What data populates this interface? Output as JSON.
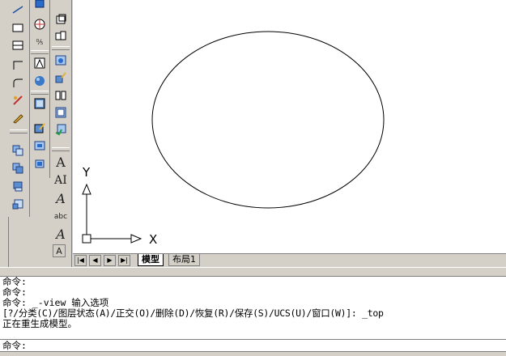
{
  "icons": {
    "col1": [
      "line-icon",
      "rectangle-icon",
      "polyline-icon",
      "arc-icon",
      "hatch-icon",
      "pen-icon",
      "copy-icon",
      "move-icon",
      "array-icon",
      "scale-icon"
    ],
    "col2": [
      "3d-box-icon",
      "globe-icon",
      "ruler-icon",
      "view-icon",
      "sphere-icon",
      "plane-icon",
      "edit-icon",
      "render-icon",
      "cube-icon"
    ],
    "col3": [
      "3d-view-icon",
      "3d-orbit-icon",
      "camera-icon",
      "paint-icon",
      "layers-icon",
      "solid-icon",
      "rotate-icon"
    ]
  },
  "text_tools": {
    "t1": "A",
    "t2": "AI",
    "t3": "A",
    "t4": "abc",
    "t5": "A",
    "t6": "A"
  },
  "ucs": {
    "y_label": "Y",
    "x_label": "X"
  },
  "tabs": {
    "nav": [
      "|◀",
      "◀",
      "▶",
      "▶|"
    ],
    "model": "模型",
    "layout1": "布局1"
  },
  "command": {
    "history": [
      "命令:",
      "命令:",
      "命令: _-view 输入选项",
      "[?/分类(C)/图层状态(A)/正交(O)/删除(D)/恢复(R)/保存(S)/UCS(U)/窗口(W)]: _top",
      "正在重生成模型。"
    ],
    "prompt": "命令:"
  },
  "colors": {
    "ui_gray": "#d4d0c8",
    "canvas": "#ffffff",
    "accent_blue": "#2a6ccc"
  }
}
